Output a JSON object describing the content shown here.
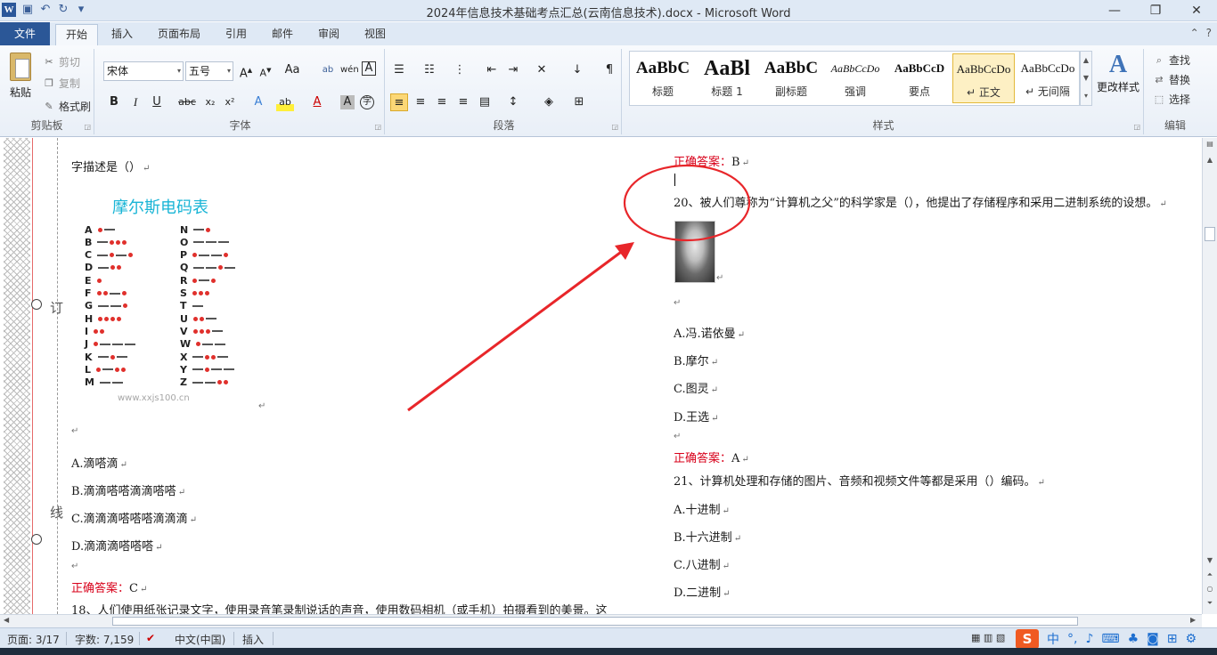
{
  "window": {
    "title": "2024年信息技术基础考点汇总(云南信息技术).docx - Microsoft Word"
  },
  "ribbon_tabs": [
    "文件",
    "开始",
    "插入",
    "页面布局",
    "引用",
    "邮件",
    "审阅",
    "视图"
  ],
  "clipboard": {
    "paste": "粘贴",
    "cut": "剪切",
    "copy": "复制",
    "format_painter": "格式刷",
    "group_label": "剪贴板"
  },
  "font": {
    "name": "宋体",
    "size": "五号",
    "group_label": "字体"
  },
  "paragraph": {
    "group_label": "段落"
  },
  "styles": {
    "group_label": "样式",
    "items": [
      {
        "sample": "AaBbC",
        "name": "标题"
      },
      {
        "sample": "AaBl",
        "name": "标题 1"
      },
      {
        "sample": "AaBbC",
        "name": "副标题"
      },
      {
        "sample": "AaBbCcDo",
        "name": "强调"
      },
      {
        "sample": "AaBbCcD",
        "name": "要点"
      },
      {
        "sample": "AaBbCcDo",
        "name": "正文"
      },
      {
        "sample": "AaBbCcDo",
        "name": "无间隔"
      }
    ],
    "change_styles": "更改样式"
  },
  "editing": {
    "find": "查找",
    "replace": "替换",
    "select": "选择",
    "group_label": "编辑"
  },
  "document": {
    "left_column": {
      "q_tail": "字描述是（）",
      "morse_title": "摩尔斯电码表",
      "watermark": "www.xxjs100.cn",
      "options": [
        "A.滴嗒滴",
        "B.滴滴嗒嗒滴滴嗒嗒",
        "C.滴滴滴嗒嗒嗒滴滴滴",
        "D.滴滴滴嗒嗒嗒"
      ],
      "answer_label": "正确答案：",
      "answer": "C",
      "next_question": "18、人们使用纸张记录文字，使用录音笔录制说话的声音，使用数码相机（或手机）拍摄看到的美景。这"
    },
    "margin_chars": [
      "订",
      "线"
    ],
    "right_column": {
      "answer_top_label": "正确答案：",
      "answer_top": "B",
      "q20": "20、被人们尊称为“计算机之父”的科学家是（），他提出了存储程序和采用二进制系统的设想。",
      "q20_options": [
        "A.冯.诺依曼",
        "B.摩尔",
        "C.图灵",
        "D.王选"
      ],
      "q20_answer_label": "正确答案：",
      "q20_answer": "A",
      "q21": "21、计算机处理和存储的图片、音频和视频文件等都是采用（）编码。",
      "q21_options": [
        "A.十进制",
        "B.十六进制",
        "C.八进制",
        "D.二进制"
      ]
    }
  },
  "status_bar": {
    "page": "页面: 3/17",
    "words": "字数: 7,159",
    "language": "中文(中国)",
    "mode": "插入"
  },
  "ime": {
    "logo": "S",
    "lang": "中"
  },
  "colors": {
    "file_tab": "#2b5797",
    "answer_red": "#d8001a",
    "annotation_red": "#e8262a",
    "morse_title": "#1ab5d6"
  }
}
